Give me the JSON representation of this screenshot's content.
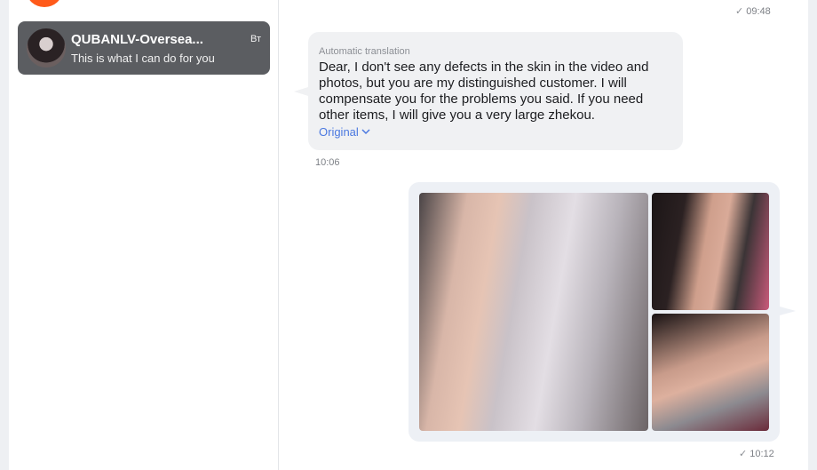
{
  "chat_list": {
    "active_chat": {
      "name": "QUBANLV-Oversea...",
      "day": "Вт",
      "preview": "This is what I can do for you"
    }
  },
  "messages": {
    "top_time": "09:48",
    "incoming": {
      "auto_label": "Automatic translation",
      "text": "Dear, I don't see any defects in the skin in the video and photos, but you are my distinguished customer. I will compensate you for the problems you said. If you need other items, I will give you a very large zhekou.",
      "original_link": "Original",
      "time": "10:06"
    },
    "outgoing": {
      "photo_count": 3,
      "time": "10:12"
    }
  },
  "colors": {
    "active_chat_bg": "#5b5d61",
    "incoming_bubble": "#f0f1f3",
    "outgoing_bubble": "#edf0f5",
    "link": "#4a78e0",
    "accent_avatar": "#ff5a1a"
  }
}
